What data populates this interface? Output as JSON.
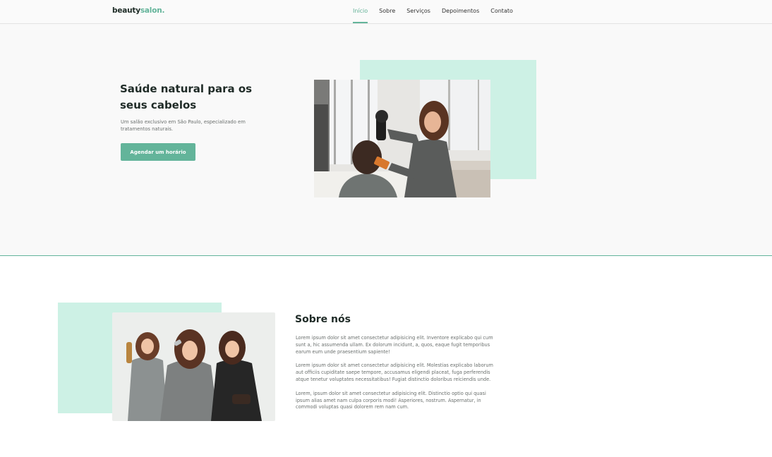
{
  "header": {
    "logo_part1": "beauty",
    "logo_part2": "salon.",
    "nav": [
      "Início",
      "Sobre",
      "Serviços",
      "Depoimentos",
      "Contato"
    ],
    "active_nav": "Início"
  },
  "hero": {
    "title": "Saúde natural para os seus cabelos",
    "description": "Um salão exclusivo em São Paulo, especializado em tratamentos naturais.",
    "cta_label": "Agendar um horário"
  },
  "about": {
    "title": "Sobre nós",
    "paragraphs": [
      "Lorem ipsum dolor sit amet consectetur adipisicing elit. Inventore explicabo qui cum sunt a, hic assumenda ullam. Ex dolorum incidunt, a, quos, eaque fugit temporibus earum eum unde praesentium sapiente!",
      "Lorem ipsum dolor sit amet consectetur adipisicing elit. Molestias explicabo laborum aut officiis cupiditate saepe tempore, accusamus eligendi placeat, fuga perferendis atque tenetur voluptates necessitatibus! Fugiat distinctio doloribus reiciendis unde.",
      "Lorem, ipsum dolor sit amet consectetur adipisicing elit. Distinctio optio qui quasi ipsum alias amet nam culpa corporis modi! Asperiores, nostrum. Aspernatur, in commodi voluptas quasi dolorem rem nam cum."
    ]
  },
  "colors": {
    "accent": "#63b49a",
    "mint": "#cdf1e5",
    "dark_text": "#1f2b27"
  }
}
